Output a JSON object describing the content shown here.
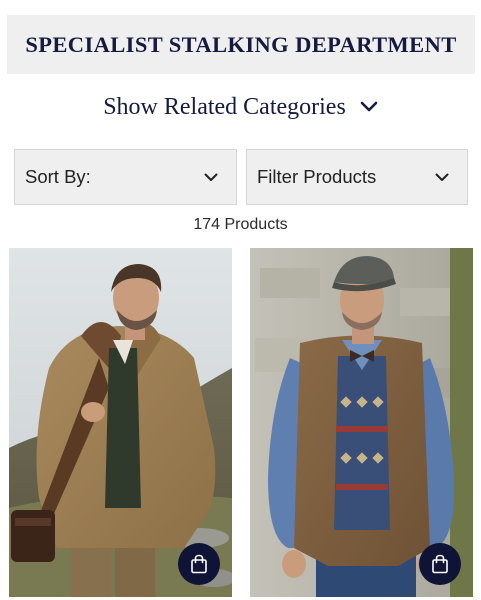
{
  "department": {
    "title": "SPECIALIST STALKING DEPARTMENT"
  },
  "related": {
    "label": "Show Related Categories",
    "icon": "chevron-down-icon"
  },
  "controls": {
    "sort_label": "Sort By:",
    "filter_label": "Filter Products"
  },
  "results": {
    "count_text": "174 Products"
  },
  "products": [
    {
      "image": "man-in-tweed-field-coat",
      "action_icon": "shopping-bag-icon"
    },
    {
      "image": "man-in-tweed-waistcoat-and-flat-cap",
      "action_icon": "shopping-bag-icon"
    }
  ],
  "colors": {
    "brand_navy": "#141a40",
    "button_navy": "#0f1436",
    "panel_grey": "#efefef"
  }
}
